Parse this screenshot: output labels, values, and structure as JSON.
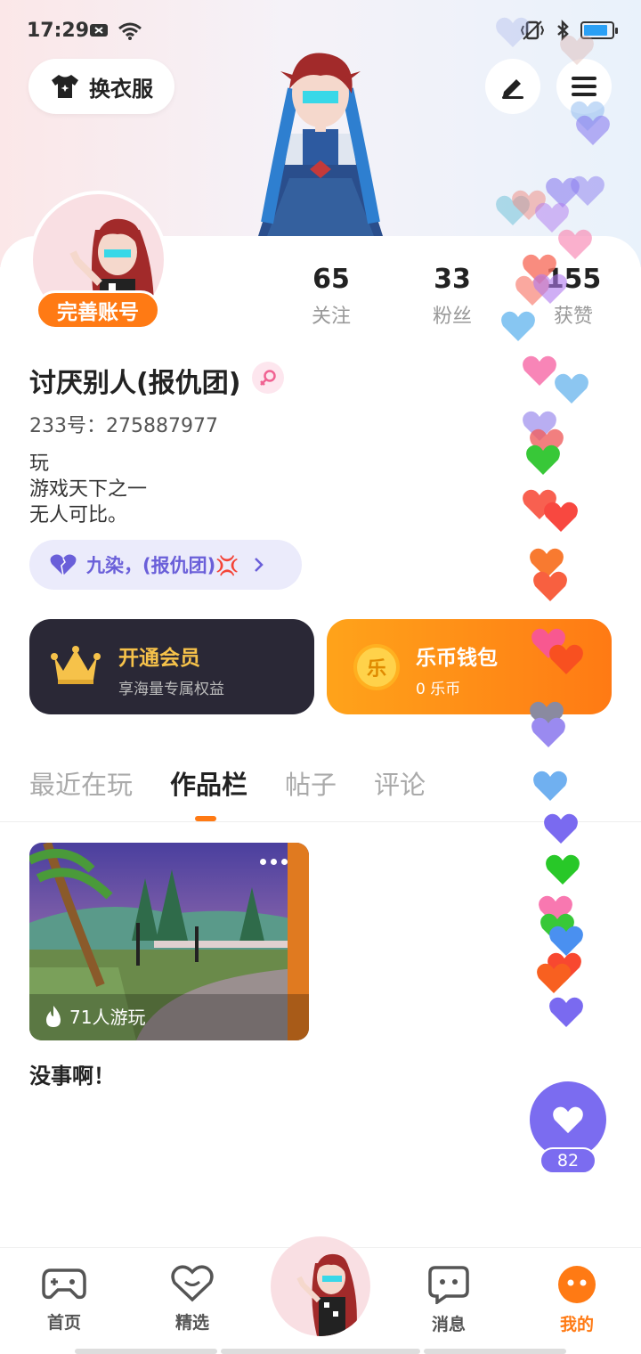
{
  "status": {
    "time": "17:29",
    "battery_color": "#2aa0f5"
  },
  "header": {
    "outfit_label": "换衣服",
    "edit_icon": "pen-icon",
    "menu_icon": "menu-icon"
  },
  "profile": {
    "badge": "完善账号",
    "stats": [
      {
        "value": "65",
        "label": "关注"
      },
      {
        "value": "33",
        "label": "粉丝"
      },
      {
        "value": "155",
        "label": "获赞"
      }
    ],
    "username": "讨厌别人(报仇团)",
    "gender_icon": "female-icon",
    "uid": "233号：275887977",
    "bio": [
      "玩",
      "游戏天下之一",
      "无人可比。"
    ],
    "relation": "九染，(报仇团)💢"
  },
  "cards": {
    "vip": {
      "title": "开通会员",
      "subtitle": "享海量专属权益",
      "icon": "crown-icon"
    },
    "wallet": {
      "title": "乐币钱包",
      "subtitle": "0 乐币",
      "icon_text": "乐"
    }
  },
  "tabs": [
    {
      "label": "最近在玩",
      "active": false
    },
    {
      "label": "作品栏",
      "active": true
    },
    {
      "label": "帖子",
      "active": false
    },
    {
      "label": "评论",
      "active": false
    }
  ],
  "work": {
    "plays": "71人游玩",
    "title": "没事啊！"
  },
  "like": {
    "count": "82"
  },
  "nav": [
    {
      "label": "首页",
      "icon": "gamepad-icon",
      "active": false
    },
    {
      "label": "精选",
      "icon": "heart-tag-icon",
      "active": false
    },
    {
      "label": "消息",
      "icon": "chat-icon",
      "active": false
    },
    {
      "label": "我的",
      "icon": "profile-face-icon",
      "active": true
    }
  ],
  "colors": {
    "accent": "#ff7a14",
    "purple": "#7b6cf0"
  }
}
